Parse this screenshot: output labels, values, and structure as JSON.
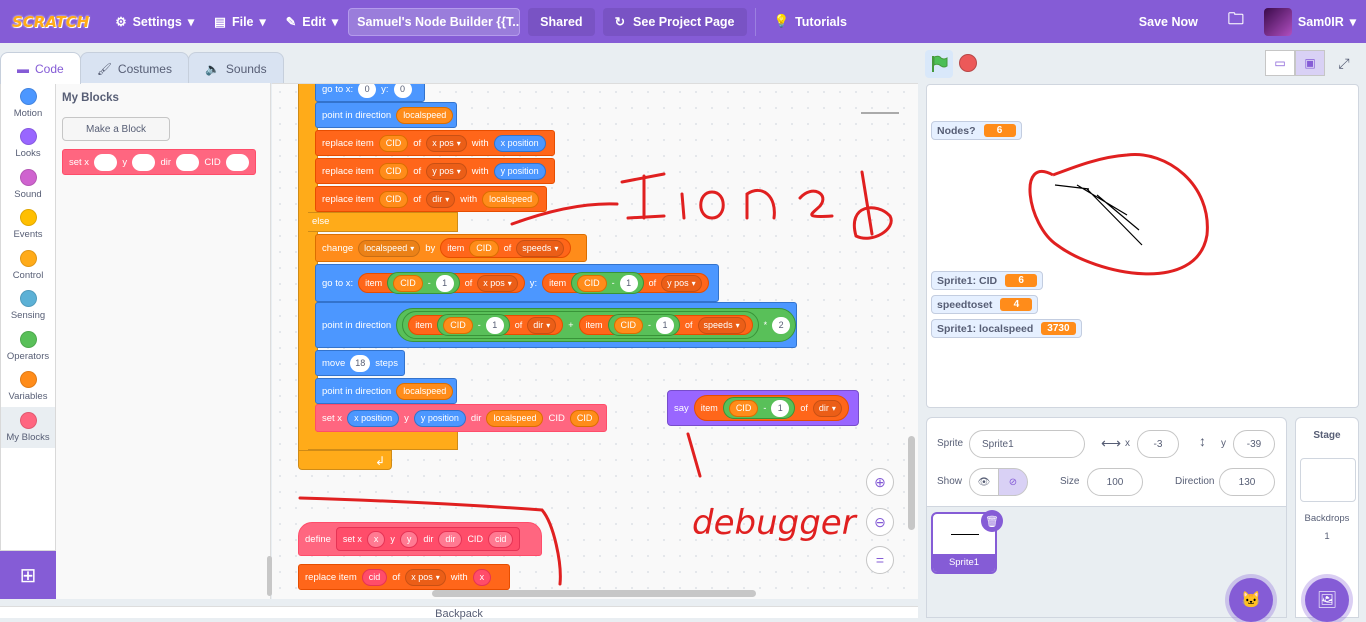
{
  "menubar": {
    "logo": "SCRATCH",
    "settings": "Settings",
    "file": "File",
    "edit": "Edit",
    "project_title": "Samuel's Node Builder {{T...",
    "shared": "Shared",
    "see_project": "See Project Page",
    "tutorials": "Tutorials",
    "save_now": "Save Now",
    "username": "Sam0IR"
  },
  "tabs": {
    "code": "Code",
    "costumes": "Costumes",
    "sounds": "Sounds"
  },
  "categories": [
    {
      "label": "Motion",
      "color": "#4c97ff"
    },
    {
      "label": "Looks",
      "color": "#9966ff"
    },
    {
      "label": "Sound",
      "color": "#cf63cf"
    },
    {
      "label": "Events",
      "color": "#ffbf00"
    },
    {
      "label": "Control",
      "color": "#ffab19"
    },
    {
      "label": "Sensing",
      "color": "#5cb1d6"
    },
    {
      "label": "Operators",
      "color": "#59c059"
    },
    {
      "label": "Variables",
      "color": "#ff8c1a"
    },
    {
      "label": "My Blocks",
      "color": "#ff6680"
    }
  ],
  "palette": {
    "title": "My Blocks",
    "make_block": "Make a Block",
    "block": {
      "set": "set x",
      "y": "y",
      "dir": "dir",
      "cid": "CID"
    }
  },
  "script": {
    "goto_top": {
      "label": "go to x:",
      "x": "0",
      "y_label": "y:",
      "y": "0"
    },
    "point1": {
      "label": "point in direction",
      "arg": "localspeed"
    },
    "replace1": {
      "label": "replace item",
      "item": "CID",
      "of": "of",
      "list": "x pos",
      "with": "with",
      "val": "x position"
    },
    "replace2": {
      "label": "replace item",
      "item": "CID",
      "of": "of",
      "list": "y pos",
      "with": "with",
      "val": "y position"
    },
    "replace3": {
      "label": "replace item",
      "item": "CID",
      "of": "of",
      "list": "dir",
      "with": "with",
      "val": "localspeed"
    },
    "else": "else",
    "change": {
      "label": "change",
      "var": "localspeed",
      "by": "by",
      "item": "item",
      "cid": "CID",
      "of": "of",
      "list": "speeds"
    },
    "goto2": {
      "label": "go to x:",
      "item": "item",
      "cid": "CID",
      "minus": "-",
      "one": "1",
      "of": "of",
      "listx": "x pos",
      "y": "y:",
      "listy": "y pos"
    },
    "point2": {
      "label": "point in direction",
      "item": "item",
      "cid": "CID",
      "minus": "-",
      "one": "1",
      "of": "of",
      "list1": "dir",
      "plus": "+",
      "list2": "speeds",
      "times": "*",
      "two": "2"
    },
    "move": {
      "label": "move",
      "steps_val": "18",
      "steps": "steps"
    },
    "point3": {
      "label": "point in direction",
      "arg": "localspeed"
    },
    "setx": {
      "label": "set x",
      "x": "x position",
      "y": "y",
      "yv": "y position",
      "dir": "dir",
      "dirv": "localspeed",
      "cid": "CID",
      "cidv": "CID"
    },
    "say": {
      "label": "say",
      "item": "item",
      "cid": "CID",
      "minus": "-",
      "one": "1",
      "of": "of",
      "list": "dir"
    },
    "define": {
      "label": "define",
      "set": "set x",
      "x": "x",
      "y": "y",
      "yv": "y",
      "dir": "dir",
      "dirv": "dir",
      "cid": "CID",
      "cidv": "cid"
    },
    "replace_bottom": {
      "label": "replace item",
      "item": "cid",
      "of": "of",
      "list": "x pos",
      "with": "with",
      "val": "x"
    }
  },
  "annotations": {
    "left": "ʎɹoned",
    "bottom": "debugger"
  },
  "backpack": "Backpack",
  "stage": {
    "monitors": [
      {
        "label": "Nodes?",
        "value": "6"
      },
      {
        "label": "Sprite1: CID",
        "value": "6"
      },
      {
        "label": "speedtoset",
        "value": "4"
      },
      {
        "label": "Sprite1: localspeed",
        "value": "3730"
      }
    ]
  },
  "sprite_info": {
    "sprite_label": "Sprite",
    "sprite_name": "Sprite1",
    "x_label": "x",
    "x": "-3",
    "y_label": "y",
    "y": "-39",
    "show_label": "Show",
    "size_label": "Size",
    "size": "100",
    "direction_label": "Direction",
    "direction": "130"
  },
  "sprites": [
    {
      "name": "Sprite1"
    }
  ],
  "stage_panel": {
    "title": "Stage",
    "backdrops": "Backdrops",
    "count": "1"
  }
}
